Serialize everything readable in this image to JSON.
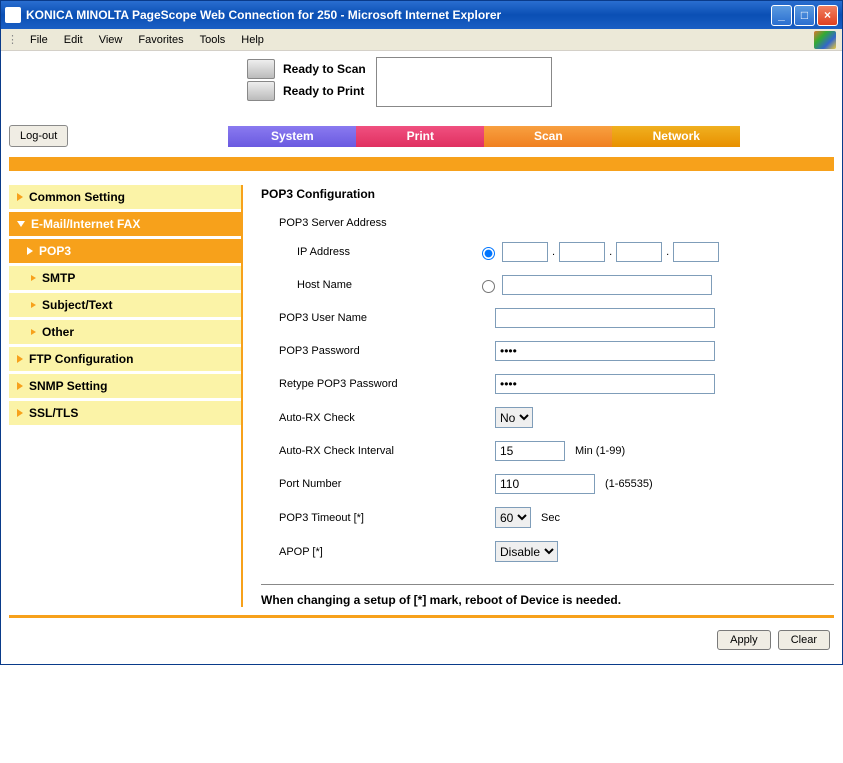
{
  "window": {
    "title": "KONICA MINOLTA PageScope Web Connection for 250 - Microsoft Internet Explorer"
  },
  "menu": {
    "file": "File",
    "edit": "Edit",
    "view": "View",
    "favorites": "Favorites",
    "tools": "Tools",
    "help": "Help"
  },
  "status": {
    "scan": "Ready to Scan",
    "print": "Ready to Print"
  },
  "logout": "Log-out",
  "tabs": {
    "system": "System",
    "print": "Print",
    "scan": "Scan",
    "network": "Network"
  },
  "sidebar": {
    "common": "Common Setting",
    "email_fax": "E-Mail/Internet FAX",
    "pop3": "POP3",
    "smtp": "SMTP",
    "subject": "Subject/Text",
    "other": "Other",
    "ftp": "FTP Configuration",
    "snmp": "SNMP Setting",
    "ssl": "SSL/TLS"
  },
  "page": {
    "heading": "POP3 Configuration",
    "server_addr": "POP3 Server Address",
    "ip_addr": "IP Address",
    "host_name": "Host Name",
    "user_name": "POP3 User Name",
    "password": "POP3 Password",
    "retype_password": "Retype POP3 Password",
    "auto_rx": "Auto-RX Check",
    "auto_rx_int": "Auto-RX Check Interval",
    "auto_rx_hint": "Min (1-99)",
    "port": "Port Number",
    "port_hint": "(1-65535)",
    "timeout": "POP3 Timeout [*]",
    "timeout_hint": "Sec",
    "apop": "APOP [*]",
    "note": "When changing a setup of [*] mark, reboot of Device is needed."
  },
  "values": {
    "password": "••••",
    "retype_password": "••••",
    "auto_rx": "No",
    "interval": "15",
    "port": "110",
    "timeout": "60",
    "apop": "Disable"
  },
  "buttons": {
    "apply": "Apply",
    "clear": "Clear"
  }
}
